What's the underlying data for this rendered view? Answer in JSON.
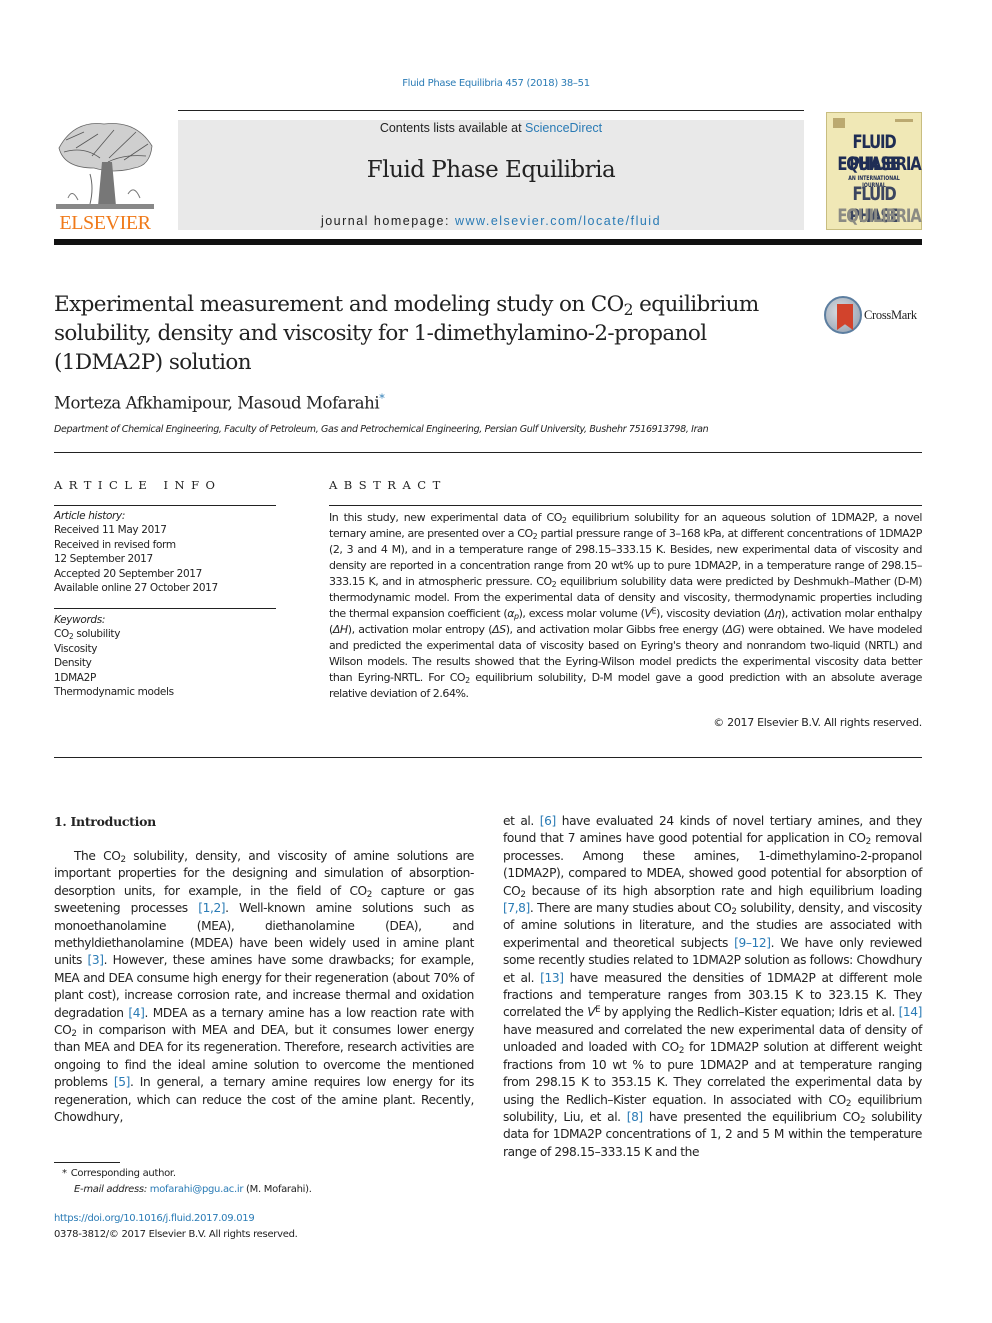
{
  "running_head": "Fluid Phase Equilibria 457 (2018) 38–51",
  "masthead": {
    "contents_prefix": "Contents lists available at ",
    "contents_link": "ScienceDirect",
    "journal_title": "Fluid Phase Equilibria",
    "homepage_prefix": "journal homepage: ",
    "homepage_link": "www.elsevier.com/locate/fluid"
  },
  "publisher": {
    "name": "ELSEVIER",
    "brand_color": "#f07a1a"
  },
  "cover": {
    "lines": [
      "FLUID PHASE",
      "EQUILIBRIA",
      "AN INTERNATIONAL JOURNAL",
      "FLUID PHASE",
      "EQUILIBRIA"
    ]
  },
  "article": {
    "title_part1": "Experimental measurement and modeling study on CO",
    "title_sub": "2",
    "title_part2": " equilibrium solubility, density and viscosity for 1-dimethylamino-2-propanol (1DMA2P) solution",
    "crossmark_label": "CrossMark",
    "authors": "Morteza Afkhamipour, Masoud Mofarahi",
    "author_mark": "*",
    "affiliation": "Department of Chemical Engineering, Faculty of Petroleum, Gas and Petrochemical Engineering, Persian Gulf University, Bushehr 7516913798, Iran"
  },
  "article_info": {
    "heading": "ARTICLE INFO",
    "history_label": "Article history:",
    "history": [
      "Received 11 May 2017",
      "Received in revised form",
      "12 September 2017",
      "Accepted 20 September 2017",
      "Available online 27 October 2017"
    ],
    "keywords_label": "Keywords:",
    "keywords": [
      {
        "pre": "CO",
        "sub": "2",
        "post": " solubility"
      },
      {
        "pre": "Viscosity",
        "sub": "",
        "post": ""
      },
      {
        "pre": "Density",
        "sub": "",
        "post": ""
      },
      {
        "pre": "1DMA2P",
        "sub": "",
        "post": ""
      },
      {
        "pre": "Thermodynamic models",
        "sub": "",
        "post": ""
      }
    ]
  },
  "abstract": {
    "heading": "ABSTRACT",
    "copyright": "© 2017 Elsevier B.V. All rights reserved.",
    "segments": [
      {
        "t": "In this study, new experimental data of CO"
      },
      {
        "sub": "2"
      },
      {
        "t": " equilibrium solubility for an aqueous solution of 1DMA2P, a novel ternary amine, are presented over a CO"
      },
      {
        "sub": "2"
      },
      {
        "t": " partial pressure range of 3–168 kPa, at different concentrations of 1DMA2P (2, 3 and 4 M), and in a temperature range of 298.15–333.15 K. Besides, new experimental data of viscosity and density are reported in a concentration range from 20 wt% up to pure 1DMA2P, in a temperature range of 298.15–333.15 K, and in atmospheric pressure. CO"
      },
      {
        "sub": "2"
      },
      {
        "t": " equilibrium solubility data were predicted by Deshmukh–Mather (D-M) thermodynamic model. From the experimental data of density and viscosity, thermodynamic properties including the thermal expansion coefficient ("
      },
      {
        "i": "α"
      },
      {
        "isub": "p"
      },
      {
        "t": "), excess molar volume ("
      },
      {
        "i": "V"
      },
      {
        "sup": "E"
      },
      {
        "t": "), viscosity deviation ("
      },
      {
        "i": "Δη"
      },
      {
        "t": "), activation molar enthalpy ("
      },
      {
        "i": "ΔH"
      },
      {
        "t": "), activation molar entropy ("
      },
      {
        "i": "ΔS"
      },
      {
        "t": "), and activation molar Gibbs free energy ("
      },
      {
        "i": "ΔG"
      },
      {
        "t": ") were obtained. We have modeled and predicted the experimental data of viscosity based on Eyring's theory and nonrandom two-liquid (NRTL) and Wilson models. The results showed that the Eyring-Wilson model predicts the experimental viscosity data better than Eyring-NRTL. For CO"
      },
      {
        "sub": "2"
      },
      {
        "t": " equilibrium solubility, D-M model gave a good prediction with an absolute average relative deviation of 2.64%."
      }
    ]
  },
  "introduction": {
    "heading": "1.  Introduction",
    "left_segments": [
      {
        "t": "The CO"
      },
      {
        "sub": "2"
      },
      {
        "t": " solubility, density, and viscosity of amine solutions are important properties for the designing and simulation of absorption-desorption units, for example, in the field of CO"
      },
      {
        "sub": "2"
      },
      {
        "t": " capture or gas sweetening processes "
      },
      {
        "ref": "[1,2]"
      },
      {
        "t": ". Well-known amine solutions such as monoethanolamine (MEA), diethanolamine (DEA), and methyldiethanolamine (MDEA) have been widely used in amine plant units "
      },
      {
        "ref": "[3]"
      },
      {
        "t": ". However, these amines have some drawbacks; for example, MEA and DEA consume high energy for their regeneration (about 70% of plant cost), increase corrosion rate, and increase thermal and oxidation degradation "
      },
      {
        "ref": "[4]"
      },
      {
        "t": ". MDEA as a ternary amine has a low reaction rate with CO"
      },
      {
        "sub": "2"
      },
      {
        "t": " in comparison with MEA and DEA, but it consumes lower energy than MEA and DEA for its regeneration. Therefore, research activities are ongoing to find the ideal amine solution to overcome the mentioned problems "
      },
      {
        "ref": "[5]"
      },
      {
        "t": ". In general, a ternary amine requires low energy for its regeneration, which can reduce the cost of the amine plant. Recently, Chowdhury,"
      }
    ],
    "right_segments": [
      {
        "t": "et al. "
      },
      {
        "ref": "[6]"
      },
      {
        "t": " have evaluated 24 kinds of novel tertiary amines, and they found that 7 amines have good potential for application in CO"
      },
      {
        "sub": "2"
      },
      {
        "t": " removal processes. Among these amines, 1-dimethylamino-2-propanol (1DMA2P), compared to MDEA, showed good potential for absorption of CO"
      },
      {
        "sub": "2"
      },
      {
        "t": " because of its high absorption rate and high equilibrium loading "
      },
      {
        "ref": "[7,8]"
      },
      {
        "t": ". There are many studies about CO"
      },
      {
        "sub": "2"
      },
      {
        "t": " solubility, density, and viscosity of amine solutions in literature, and the studies are associated with experimental and theoretical subjects "
      },
      {
        "ref": "[9–12]"
      },
      {
        "t": ". We have only reviewed some recently studies related to 1DMA2P solution as follows: Chowdhury et al. "
      },
      {
        "ref": "[13]"
      },
      {
        "t": " have measured the densities of 1DMA2P at different mole fractions and temperature ranges from 303.15 K to 323.15 K. They correlated the "
      },
      {
        "i": "V"
      },
      {
        "sup": "E"
      },
      {
        "t": " by applying the Redlich–Kister equation; Idris et al. "
      },
      {
        "ref": "[14]"
      },
      {
        "t": " have measured and correlated the new experimental data of density of unloaded and loaded with CO"
      },
      {
        "sub": "2"
      },
      {
        "t": " for 1DMA2P solution at different weight fractions from 10 wt % to pure 1DMA2P and at temperature ranging from 298.15 K to 353.15 K. They correlated the experimental data by using the Redlich–Kister equation. In associated with CO"
      },
      {
        "sub": "2"
      },
      {
        "t": " equilibrium solubility, Liu, et al. "
      },
      {
        "ref": "[8]"
      },
      {
        "t": " have presented the equilibrium CO"
      },
      {
        "sub": "2"
      },
      {
        "t": " solubility data for 1DMA2P concentrations of 1, 2 and 5 M within the temperature range of 298.15–333.15 K and the"
      }
    ]
  },
  "footnotes": {
    "star": "*",
    "corresponding": "Corresponding author.",
    "email_label": "E-mail address: ",
    "email": "mofarahi@pgu.ac.ir",
    "email_suffix": " (M. Mofarahi).",
    "doi": "https://doi.org/10.1016/j.fluid.2017.09.019",
    "issn_line": "0378-3812/© 2017 Elsevier B.V. All rights reserved."
  },
  "colors": {
    "link": "#2a7bb5",
    "masthead_bg": "#e9e9e9",
    "cover_bg": "#f0e8b6",
    "cover_text": "#1f2d54"
  }
}
